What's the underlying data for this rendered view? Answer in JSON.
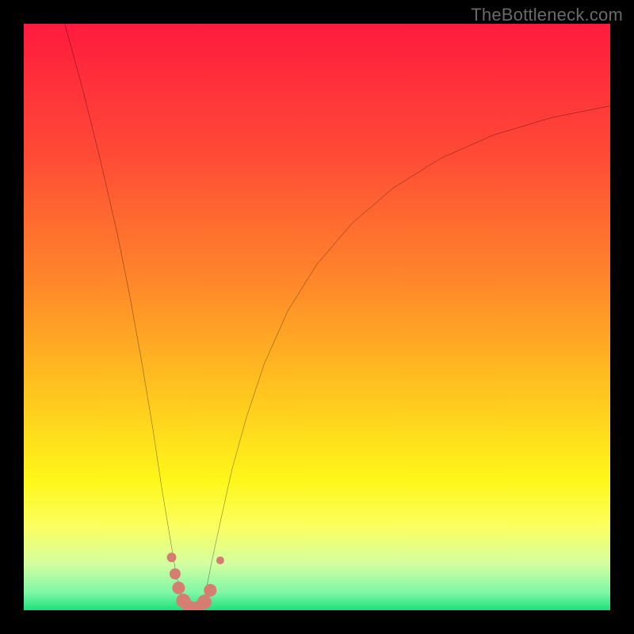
{
  "watermark": "TheBottleneck.com",
  "chart_data": {
    "type": "line",
    "title": "",
    "xlabel": "",
    "ylabel": "",
    "xlim": [
      0,
      100
    ],
    "ylim": [
      0,
      100
    ],
    "grid": false,
    "legend": false,
    "background_gradient": {
      "stops": [
        {
          "offset": 0.0,
          "color": "#ff1a3e"
        },
        {
          "offset": 0.22,
          "color": "#ff4a36"
        },
        {
          "offset": 0.45,
          "color": "#ff8a2a"
        },
        {
          "offset": 0.62,
          "color": "#ffc21f"
        },
        {
          "offset": 0.78,
          "color": "#fff71a"
        },
        {
          "offset": 0.86,
          "color": "#fbff62"
        },
        {
          "offset": 0.92,
          "color": "#d4ffa0"
        },
        {
          "offset": 0.97,
          "color": "#7ef7a6"
        },
        {
          "offset": 1.0,
          "color": "#1fe07a"
        }
      ]
    },
    "series": [
      {
        "name": "bottleneck-left",
        "stroke": "#000000",
        "stroke_width": 2.2,
        "x": [
          7,
          10,
          13,
          16,
          18,
          20,
          22,
          23.5,
          25,
          26,
          27,
          27.8
        ],
        "y": [
          100,
          89,
          77,
          64,
          54,
          43,
          31,
          21,
          12,
          6,
          2,
          0
        ]
      },
      {
        "name": "bottleneck-right",
        "stroke": "#000000",
        "stroke_width": 2.2,
        "x": [
          30.2,
          31,
          32,
          33.5,
          35.5,
          38,
          41,
          45,
          50,
          56,
          63,
          71,
          80,
          90,
          100
        ],
        "y": [
          0,
          3,
          8,
          15,
          24,
          33,
          42,
          51,
          59,
          66,
          72,
          77,
          81,
          84,
          86
        ]
      },
      {
        "name": "valley-floor",
        "stroke": "#000000",
        "stroke_width": 2.2,
        "x": [
          27.8,
          28.5,
          29.2,
          30.2
        ],
        "y": [
          0,
          -0.4,
          -0.4,
          0
        ]
      }
    ],
    "markers": [
      {
        "name": "marker-1",
        "x": 25.2,
        "y": 9.0,
        "r": 6,
        "color": "#d67d72"
      },
      {
        "name": "marker-2",
        "x": 25.8,
        "y": 6.2,
        "r": 7,
        "color": "#d67d72"
      },
      {
        "name": "marker-3",
        "x": 26.4,
        "y": 3.8,
        "r": 8,
        "color": "#d67d72"
      },
      {
        "name": "marker-4",
        "x": 27.2,
        "y": 1.6,
        "r": 9,
        "color": "#d67d72"
      },
      {
        "name": "marker-5",
        "x": 28.3,
        "y": 0.4,
        "r": 9,
        "color": "#d67d72"
      },
      {
        "name": "marker-6",
        "x": 29.6,
        "y": 0.3,
        "r": 9,
        "color": "#d67d72"
      },
      {
        "name": "marker-7",
        "x": 30.8,
        "y": 1.4,
        "r": 9,
        "color": "#d67d72"
      },
      {
        "name": "marker-8",
        "x": 31.8,
        "y": 3.4,
        "r": 8,
        "color": "#d67d72"
      },
      {
        "name": "marker-9",
        "x": 33.5,
        "y": 8.5,
        "r": 5,
        "color": "#d67d72"
      }
    ]
  }
}
